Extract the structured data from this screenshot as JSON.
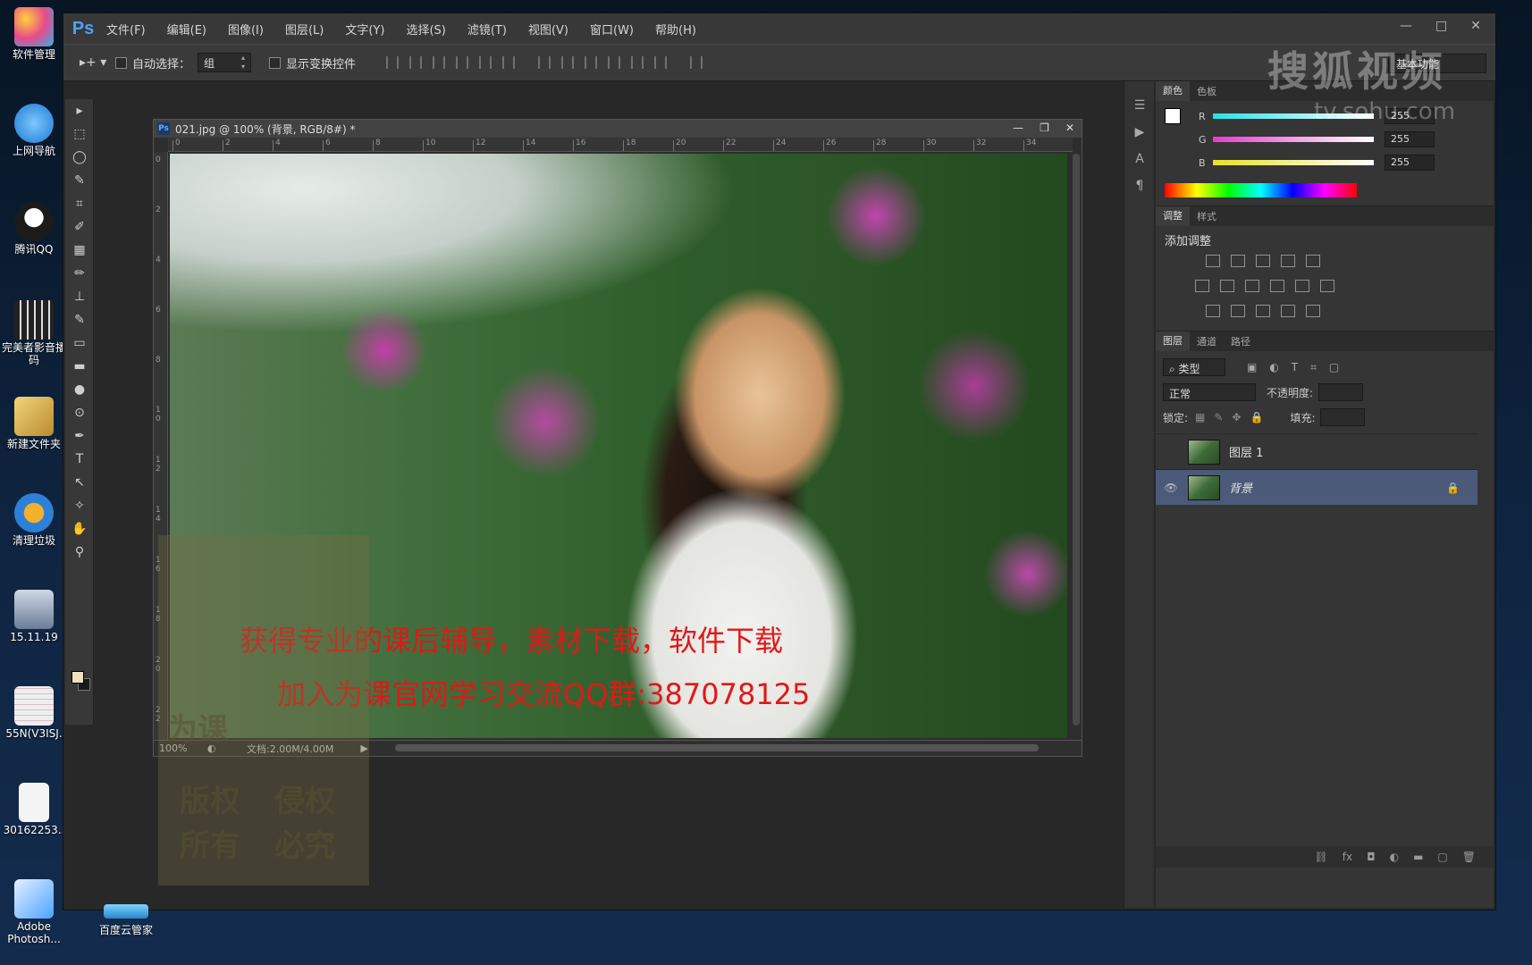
{
  "desktop": {
    "icons": [
      {
        "label": "软件管理",
        "color": "#e84a8a"
      },
      {
        "label": "上网导航",
        "color": "#2a8fe0"
      },
      {
        "label": "腾讯QQ",
        "color": "#1b1b1b"
      },
      {
        "label": "完美者影音播",
        "label2": "码",
        "color": "#3a3a3a"
      },
      {
        "label": "新建文件夹",
        "color": "#c9a24a"
      },
      {
        "label": "清理垃圾",
        "color": "#2e7fd6"
      },
      {
        "label": "15.11.19",
        "color": "#6a7d99"
      },
      {
        "label": "55N(V3ISJ.",
        "color": "#dcdcdc"
      },
      {
        "label": "30162253..",
        "color": "#f4f4f4"
      },
      {
        "label": "Adobe",
        "label2": "Photosh...",
        "color": "#4aa3ff"
      }
    ],
    "baidu_label": "百度云管家"
  },
  "ps": {
    "logo": "Ps",
    "menus": [
      "文件(F)",
      "编辑(E)",
      "图像(I)",
      "图层(L)",
      "文字(Y)",
      "选择(S)",
      "滤镜(T)",
      "视图(V)",
      "窗口(W)",
      "帮助(H)"
    ],
    "window_controls": [
      "—",
      "□",
      "✕"
    ],
    "options": {
      "auto_select_label": "自动选择：",
      "group_value": "组",
      "show_transform_label": "显示变换控件",
      "workspace": "基本功能"
    },
    "tools": [
      "▸",
      "⬚",
      "◯",
      "✎",
      "⌗",
      "✐",
      "▦",
      "✏",
      "⊥",
      "✎",
      "▭",
      "▬",
      "●",
      "⊙",
      "✒",
      "T",
      "↖",
      "✧",
      "✋",
      "⚲"
    ]
  },
  "document": {
    "title": "021.jpg @ 100% (背景, RGB/8#) *",
    "controls": [
      "—",
      "❐",
      "✕"
    ],
    "ruler_h": [
      "0",
      "2",
      "4",
      "6",
      "8",
      "10",
      "12",
      "14",
      "16",
      "18",
      "20",
      "22",
      "24",
      "26",
      "28",
      "30",
      "32",
      "34"
    ],
    "ruler_v": [
      "0",
      "2",
      "4",
      "6",
      "8",
      "1 0",
      "1 2",
      "1 4",
      "1 6",
      "1 8",
      "2 0",
      "2 2"
    ],
    "zoom": "100%",
    "doc_size": "文档:2.00M/4.00M",
    "promo_line1": "获得专业的课后辅导，素材下载，软件下载",
    "promo_line2": "加入为课官网学习交流QQ群:387078125",
    "watermark_words": [
      "为课",
      "版权",
      "侵权",
      "所有",
      "必究"
    ]
  },
  "panels": {
    "color_tabs": [
      "颜色",
      "色板"
    ],
    "rgb": [
      {
        "channel": "R",
        "value": "255",
        "color": "#2be0e8"
      },
      {
        "channel": "G",
        "value": "255",
        "color": "#e83ad0"
      },
      {
        "channel": "B",
        "value": "255",
        "color": "#e8e02a"
      }
    ],
    "adjust_tabs": [
      "调整",
      "样式"
    ],
    "adjust_title": "添加调整",
    "layers_tabs": [
      "图层",
      "通道",
      "路径"
    ],
    "kind_filter": "⌕ 类型",
    "blend_mode": "正常",
    "opacity_label": "不透明度:",
    "lock_label": "锁定:",
    "fill_label": "填充:",
    "layers": [
      {
        "name": "图层 1",
        "visible": ""
      },
      {
        "name": "背景",
        "visible": "👁"
      }
    ],
    "lock_icon": "🔒"
  },
  "watermark": {
    "brand": "搜狐视频",
    "url": "tv.sohu.com"
  }
}
